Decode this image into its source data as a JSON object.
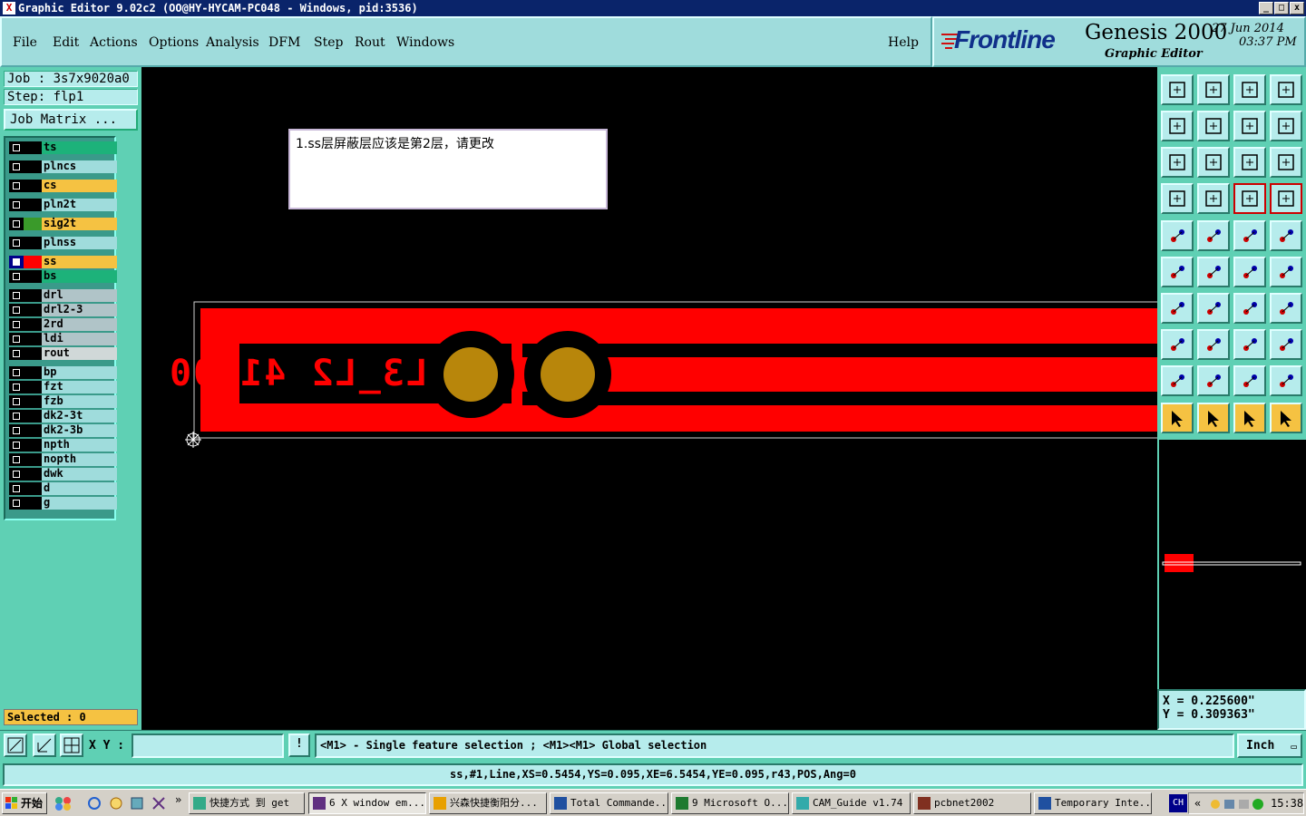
{
  "window": {
    "title": "Graphic Editor 9.02c2 (OO@HY-HYCAM-PC048 - Windows, pid:3536)",
    "minimize": "_",
    "maximize": "□",
    "close": "x"
  },
  "menu": {
    "file": "File",
    "edit": "Edit",
    "actions": "Actions",
    "options": "Options",
    "analysis": "Analysis",
    "dfm": "DFM",
    "step": "Step",
    "rout": "Rout",
    "windows": "Windows",
    "help": "Help"
  },
  "brand": {
    "logo": "Frontline",
    "product": "Genesis 2000",
    "module": "Graphic Editor",
    "date": "27 Jun 2014",
    "time": "03:37 PM"
  },
  "left": {
    "job": "Job : 3s7x9020a0",
    "step": "Step: flp1",
    "job_matrix": "Job Matrix ...",
    "selected": "Selected : 0"
  },
  "layers": [
    {
      "name": "ts",
      "color": "#1db27a",
      "swatch": "#000000",
      "active": false
    },
    {
      "name": "plncs",
      "color": "#9fdcdc",
      "swatch": "#000000",
      "active": false
    },
    {
      "name": "cs",
      "color": "#f5c242",
      "swatch": "#000000",
      "active": false
    },
    {
      "name": "pln2t",
      "color": "#9fdcdc",
      "swatch": "#000000",
      "active": false
    },
    {
      "name": "sig2t",
      "color": "#f5c242",
      "swatch": "#3a9a2a",
      "active": false
    },
    {
      "name": "plnss",
      "color": "#9fdcdc",
      "swatch": "#000000",
      "active": false
    },
    {
      "name": "ss",
      "color": "#f5c242",
      "swatch": "#ff0000",
      "active": true
    },
    {
      "name": "bs",
      "color": "#1db27a",
      "swatch": "#000000",
      "active": false
    },
    {
      "name": "drl",
      "color": "#b0c4c8",
      "swatch": "#000000",
      "active": false
    },
    {
      "name": "drl2-3",
      "color": "#b0c4c8",
      "swatch": "#000000",
      "active": false
    },
    {
      "name": "2rd",
      "color": "#b0c4c8",
      "swatch": "#000000",
      "active": false
    },
    {
      "name": "ldi",
      "color": "#b0c4c8",
      "swatch": "#000000",
      "active": false
    },
    {
      "name": "rout",
      "color": "#d0d8d8",
      "swatch": "#000000",
      "active": false
    },
    {
      "name": "bp",
      "color": "#9fdcdc",
      "swatch": "#000000",
      "active": false
    },
    {
      "name": "fzt",
      "color": "#9fdcdc",
      "swatch": "#000000",
      "active": false
    },
    {
      "name": "fzb",
      "color": "#9fdcdc",
      "swatch": "#000000",
      "active": false
    },
    {
      "name": "dk2-3t",
      "color": "#9fdcdc",
      "swatch": "#000000",
      "active": false
    },
    {
      "name": "dk2-3b",
      "color": "#9fdcdc",
      "swatch": "#000000",
      "active": false
    },
    {
      "name": "npth",
      "color": "#9fdcdc",
      "swatch": "#000000",
      "active": false
    },
    {
      "name": "nopth",
      "color": "#9fdcdc",
      "swatch": "#000000",
      "active": false
    },
    {
      "name": "dwk",
      "color": "#9fdcdc",
      "swatch": "#000000",
      "active": false
    },
    {
      "name": "d",
      "color": "#9fdcdc",
      "swatch": "#000000",
      "active": false
    },
    {
      "name": "g",
      "color": "#9fdcdc",
      "swatch": "#000000",
      "active": false
    }
  ],
  "canvas": {
    "note": "1.ss层屏蔽层应该是第2层，请更改",
    "mirrored_text": "L3_L2 41.00",
    "trace_color": "#ff0000",
    "pad_color": "#b8860b"
  },
  "coords": {
    "x": "X = 0.225600\"",
    "y": "Y = 0.309363\""
  },
  "command": {
    "xy_label": "X Y :",
    "xy_value": "",
    "bang": "!",
    "hint": "<M1> - Single feature selection ; <M1><M1> Global selection",
    "units": "Inch"
  },
  "status": "ss,#1,Line,XS=0.5454,YS=0.095,XE=6.5454,YE=0.095,r43,POS,Ang=0",
  "taskbar": {
    "start": "开始",
    "tasks": [
      {
        "label": "快捷方式 到 get",
        "icon": "shortcut-icon"
      },
      {
        "label": "6 X window em...",
        "icon": "x-window-icon",
        "active": true
      },
      {
        "label": "兴森快捷衡阳分...",
        "icon": "star-icon"
      },
      {
        "label": "Total Commande...",
        "icon": "floppy-icon"
      },
      {
        "label": "9 Microsoft O...",
        "icon": "excel-icon"
      },
      {
        "label": "CAM_Guide v1.74",
        "icon": "cam-icon"
      },
      {
        "label": "pcbnet2002",
        "icon": "pcb-icon"
      },
      {
        "label": "Temporary Inte...",
        "icon": "doc-icon"
      }
    ],
    "lang": "CH",
    "clock": "15:38"
  }
}
